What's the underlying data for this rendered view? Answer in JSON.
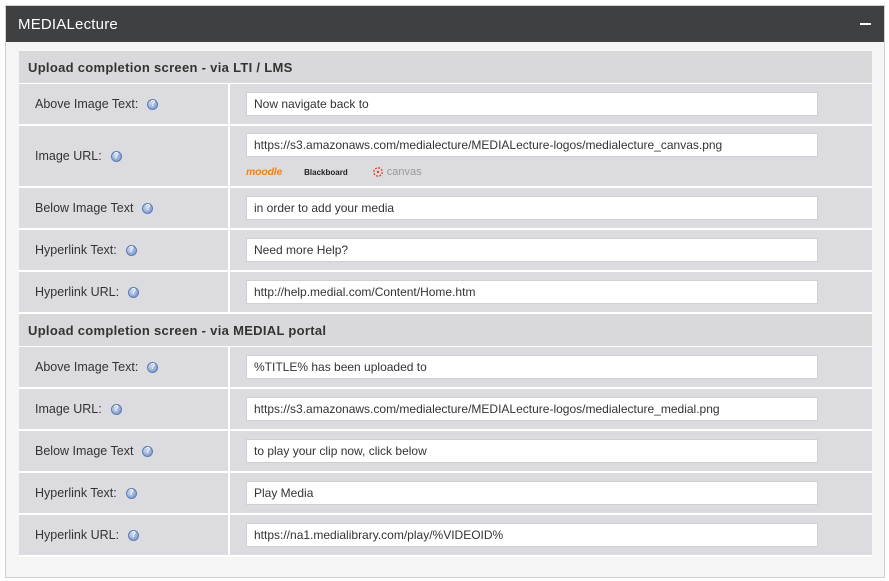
{
  "panel": {
    "title": "MEDIALecture"
  },
  "icons": {
    "collapse": "minus-icon",
    "help": "help-icon"
  },
  "sections": [
    {
      "header": "Upload completion screen - via LTI / LMS",
      "rows": [
        {
          "label": "Above Image Text:",
          "value": "Now navigate back to"
        },
        {
          "label": "Image URL:",
          "value": "https://s3.amazonaws.com/medialecture/MEDIALecture-logos/medialecture_canvas.png",
          "logos": {
            "moodle": "moodle",
            "blackboard": "Blackboard",
            "canvas": "canvas"
          }
        },
        {
          "label": "Below Image Text",
          "value": "in order to add your media"
        },
        {
          "label": "Hyperlink Text:",
          "value": "Need more Help?"
        },
        {
          "label": "Hyperlink URL:",
          "value": "http://help.medial.com/Content/Home.htm"
        }
      ]
    },
    {
      "header": "Upload completion screen - via MEDIAL portal",
      "rows": [
        {
          "label": "Above Image Text:",
          "value": "%TITLE% has been uploaded to"
        },
        {
          "label": "Image URL:",
          "value": "https://s3.amazonaws.com/medialecture/MEDIALecture-logos/medialecture_medial.png"
        },
        {
          "label": "Below Image Text",
          "value": "to play your clip now, click below"
        },
        {
          "label": "Hyperlink Text:",
          "value": "Play Media"
        },
        {
          "label": "Hyperlink URL:",
          "value": "https://na1.medialibrary.com/play/%VIDEOID%"
        }
      ]
    }
  ]
}
